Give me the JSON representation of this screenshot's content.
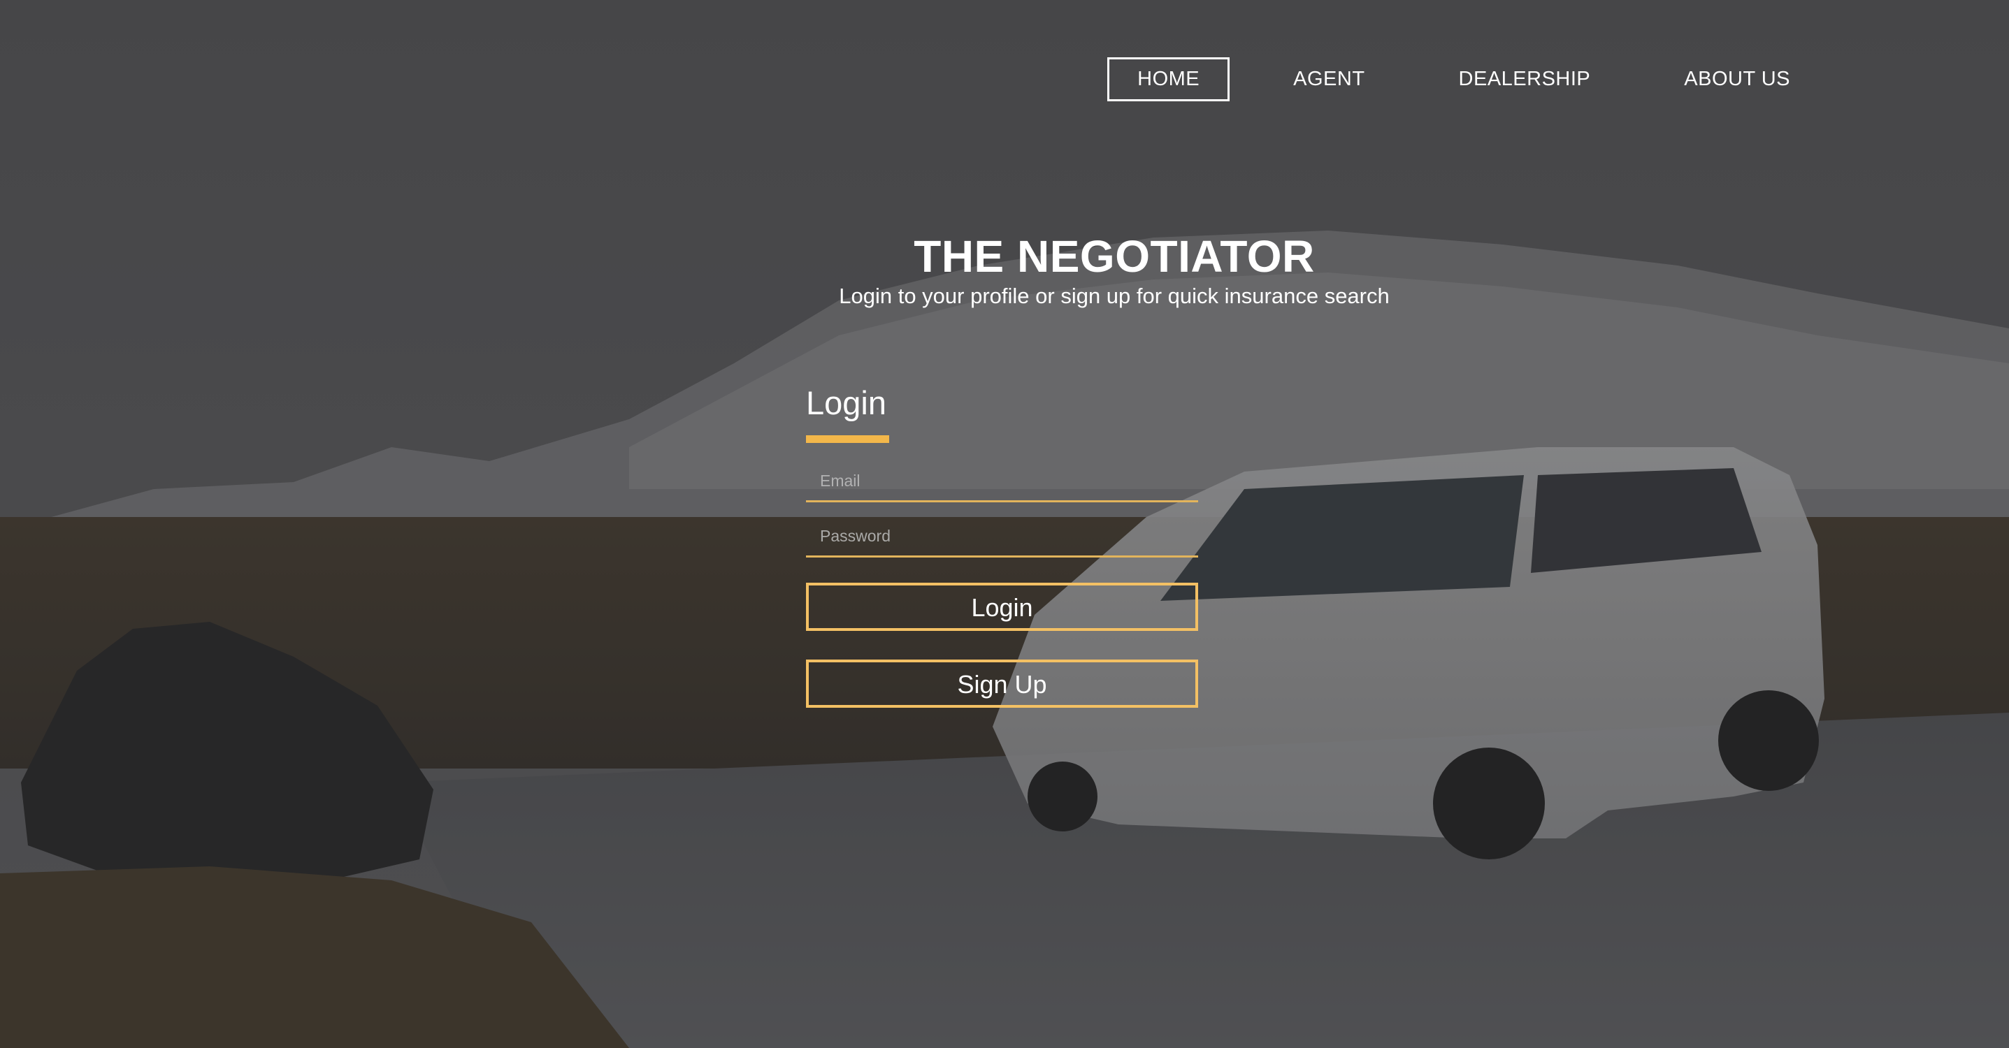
{
  "nav": {
    "items": [
      {
        "label": "HOME",
        "active": true
      },
      {
        "label": "AGENT",
        "active": false
      },
      {
        "label": "DEALERSHIP",
        "active": false
      },
      {
        "label": "ABOUT US",
        "active": false
      }
    ]
  },
  "hero": {
    "title": "THE NEGOTIATOR",
    "subtitle": "Login to your profile or sign up for quick insurance search"
  },
  "login_form": {
    "heading": "Login",
    "email": {
      "placeholder": "Email",
      "value": ""
    },
    "password": {
      "placeholder": "Password",
      "value": ""
    },
    "login_button": "Login",
    "signup_button": "Sign Up"
  },
  "colors": {
    "accent": "#f3b74a",
    "text": "#ffffff"
  },
  "background": {
    "icon": "mountain-landscape-with-white-suv"
  }
}
